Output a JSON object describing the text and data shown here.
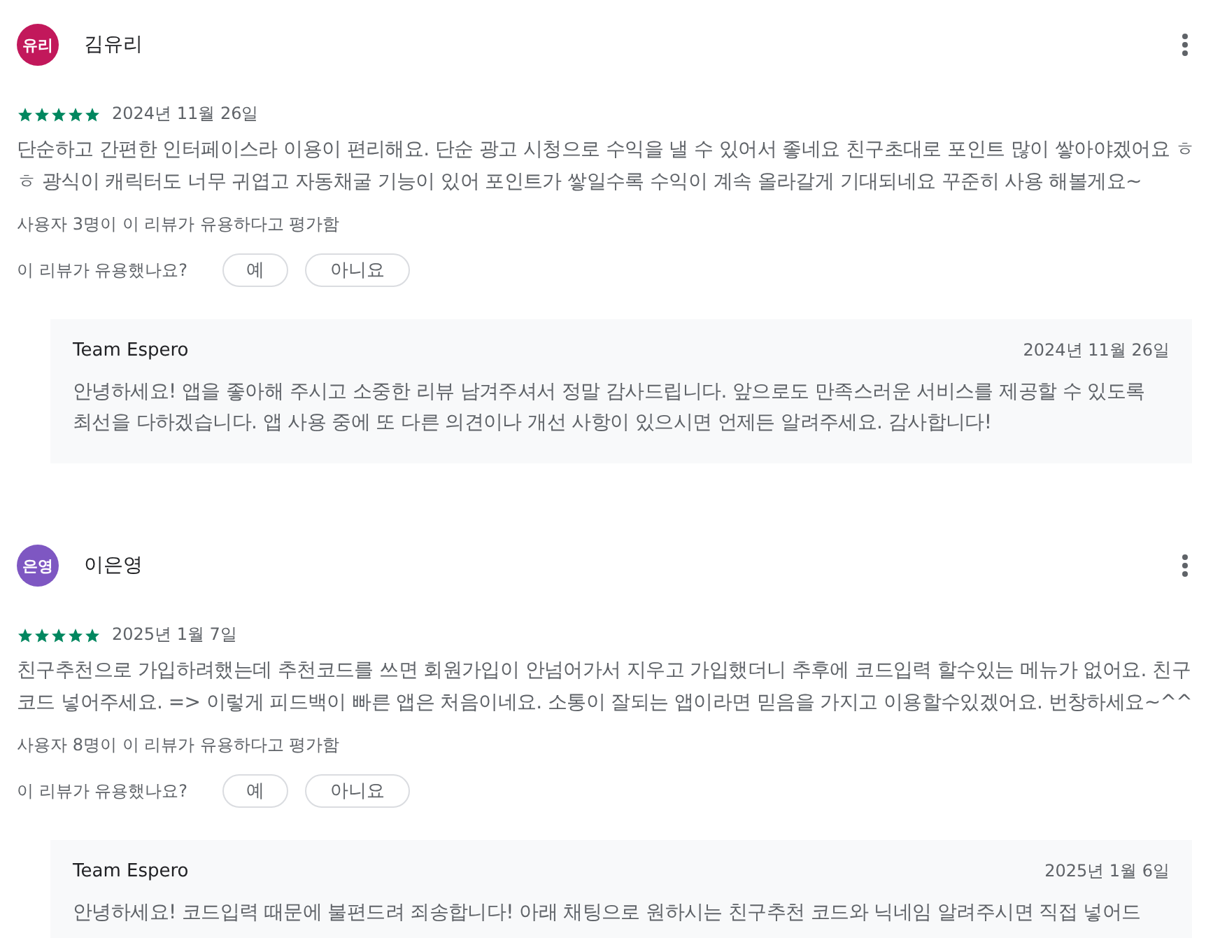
{
  "reviews": [
    {
      "avatar": {
        "text": "유리",
        "color": "#c2185b"
      },
      "author": "김유리",
      "stars": 5,
      "date": "2024년 11월 26일",
      "text": "단순하고 간편한 인터페이스라 이용이 편리해요. 단순 광고 시청으로 수익을 낼 수 있어서 좋네요 친구초대로 포인트 많이 쌓아야겠어요 ㅎㅎ 광식이 캐릭터도 너무 귀엽고 자동채굴 기능이 있어 포인트가 쌓일수록 수익이 계속 올라갈게 기대되네요 꾸준히 사용 해볼게요~",
      "helpful_count": "사용자 3명이 이 리뷰가 유용하다고 평가함",
      "helpful_question": "이 리뷰가 유용했나요?",
      "buttons": [
        "예",
        "아니요"
      ],
      "reply": {
        "author": "Team Espero",
        "date": "2024년 11월 26일",
        "text": "안녕하세요! 앱을 좋아해 주시고 소중한 리뷰 남겨주셔서 정말 감사드립니다. 앞으로도 만족스러운 서비스를 제공할 수 있도록 최선을 다하겠습니다. 앱 사용 중에 또 다른 의견이나 개선 사항이 있으시면 언제든 알려주세요. 감사합니다!"
      }
    },
    {
      "avatar": {
        "text": "은영",
        "color": "#7e57c2"
      },
      "author": "이은영",
      "stars": 5,
      "date": "2025년 1월 7일",
      "text": "친구추천으로 가입하려했는데 추천코드를 쓰면 회원가입이 안넘어가서 지우고 가입했더니 추후에 코드입력 할수있는 메뉴가 없어요. 친구코드 넣어주세요. => 이렇게 피드백이 빠른 앱은 처음이네요. 소통이 잘되는 앱이라면 믿음을 가지고 이용할수있겠어요. 번창하세요~^^",
      "helpful_count": "사용자 8명이 이 리뷰가 유용하다고 평가함",
      "helpful_question": "이 리뷰가 유용했나요?",
      "buttons": [
        "예",
        "아니요"
      ],
      "reply": {
        "author": "Team Espero",
        "date": "2025년 1월 6일",
        "text": "안녕하세요! 코드입력 때문에 불편드려 죄송합니다! 아래 채팅으로 원하시는 친구추천 코드와 닉네임 알려주시면 직접 넣어드"
      }
    }
  ]
}
